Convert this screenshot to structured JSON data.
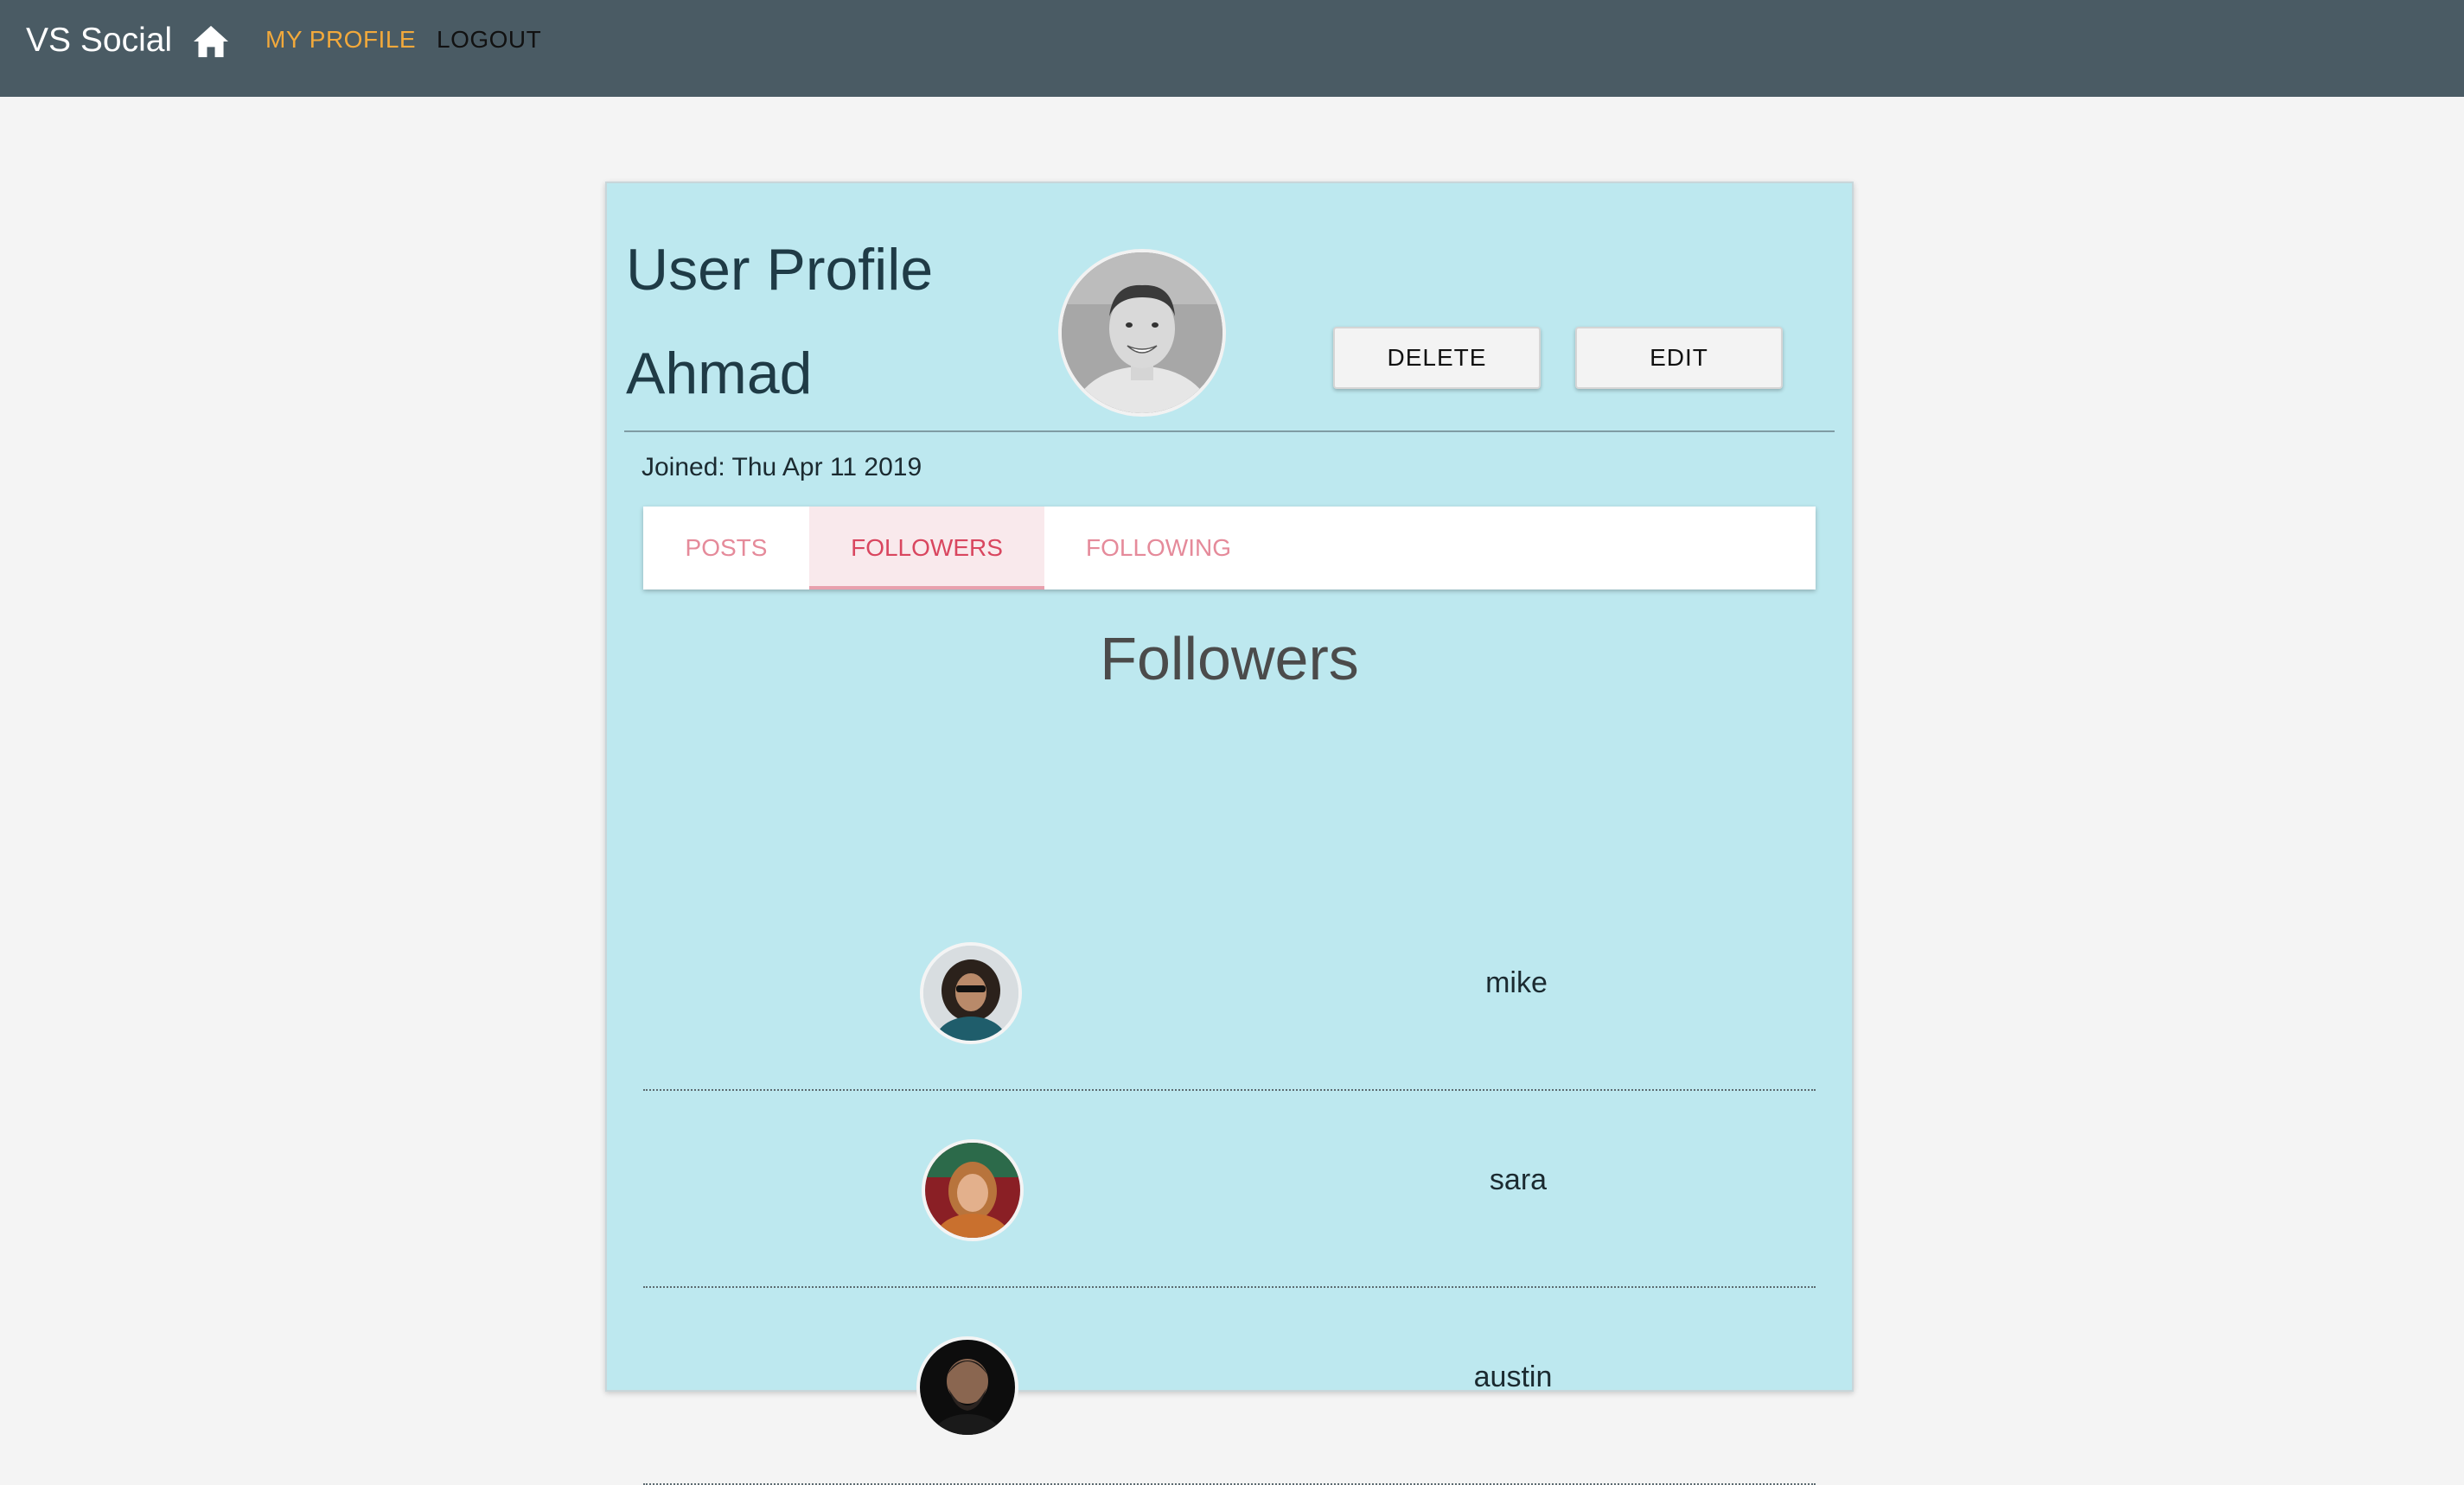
{
  "navbar": {
    "brand": "VS Social",
    "home_icon": "home-icon",
    "links": [
      {
        "label": "MY PROFILE",
        "active": true,
        "color": "#f2a93b"
      },
      {
        "label": "LOGOUT",
        "active": false,
        "color": "#111111"
      }
    ]
  },
  "profile": {
    "title": "User Profile",
    "name": "Ahmad",
    "joined": "Joined: Thu Apr 11 2019",
    "actions": {
      "delete_label": "DELETE",
      "edit_label": "EDIT"
    }
  },
  "tabs": [
    {
      "label": "POSTS",
      "active": false
    },
    {
      "label": "FOLLOWERS",
      "active": true
    },
    {
      "label": "FOLLOWING",
      "active": false
    }
  ],
  "followers": {
    "heading": "Followers",
    "items": [
      {
        "name": "mike"
      },
      {
        "name": "sara"
      },
      {
        "name": "austin"
      }
    ]
  },
  "colors": {
    "topbar": "#4a5b64",
    "card_bg": "#bde8ef",
    "accent_active_tab": "#d9465f",
    "nav_active": "#f2a93b"
  }
}
